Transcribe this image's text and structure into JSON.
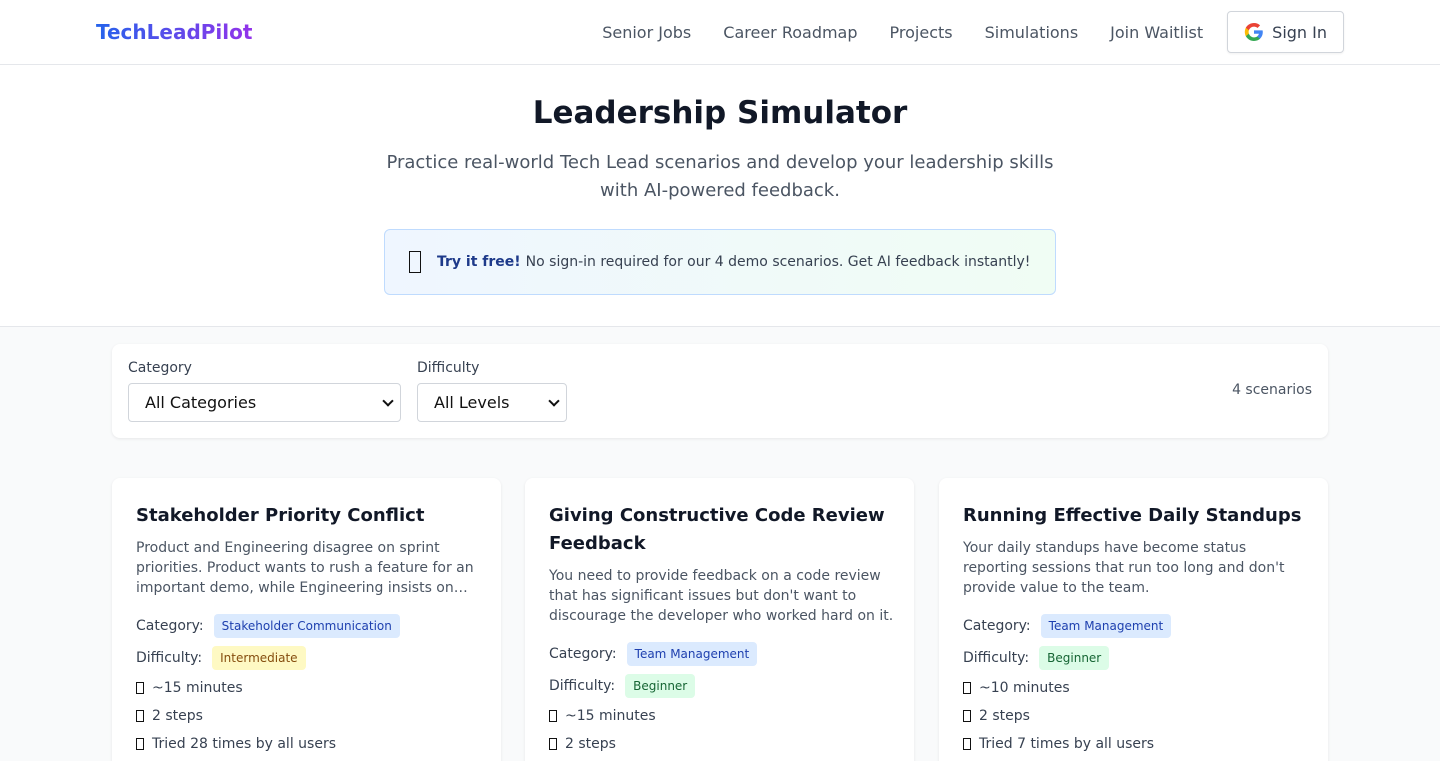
{
  "header": {
    "logo": "TechLeadPilot",
    "nav": [
      "Senior Jobs",
      "Career Roadmap",
      "Projects",
      "Simulations",
      "Join Waitlist"
    ],
    "signin_label": "Sign In"
  },
  "hero": {
    "title": "Leadership Simulator",
    "subtitle": "Practice real-world Tech Lead scenarios and develop your leadership skills with AI-powered feedback.",
    "promo_bold": "Try it free!",
    "promo_text": "No sign-in required for our 4 demo scenarios. Get AI feedback instantly!"
  },
  "filters": {
    "category_label": "Category",
    "category_value": "All Categories",
    "difficulty_label": "Difficulty",
    "difficulty_value": "All Levels",
    "count": "4 scenarios"
  },
  "labels": {
    "category": "Category:",
    "difficulty": "Difficulty:"
  },
  "cards": [
    {
      "title": "Stakeholder Priority Conflict",
      "description": "Product and Engineering disagree on sprint priorities. Product wants to rush a feature for an important demo, while Engineering insists on fixing critical technical debt first.",
      "category": "Stakeholder Communication",
      "difficulty": "Intermediate",
      "duration": "~15 minutes",
      "steps": "2 steps",
      "tried": "Tried 28 times by all users"
    },
    {
      "title": "Giving Constructive Code Review Feedback",
      "description": "You need to provide feedback on a code review that has significant issues but don't want to discourage the developer who worked hard on it.",
      "category": "Team Management",
      "difficulty": "Beginner",
      "duration": "~15 minutes",
      "steps": "2 steps"
    },
    {
      "title": "Running Effective Daily Standups",
      "description": "Your daily standups have become status reporting sessions that run too long and don't provide value to the team.",
      "category": "Team Management",
      "difficulty": "Beginner",
      "duration": "~10 minutes",
      "steps": "2 steps",
      "tried": "Tried 7 times by all users"
    }
  ],
  "colors": {
    "logo_gradient_start": "#2563eb",
    "logo_gradient_end": "#9333ea",
    "badge_blue": "#dbeafe",
    "badge_yellow": "#fef9c3",
    "badge_green": "#dcfce7"
  }
}
